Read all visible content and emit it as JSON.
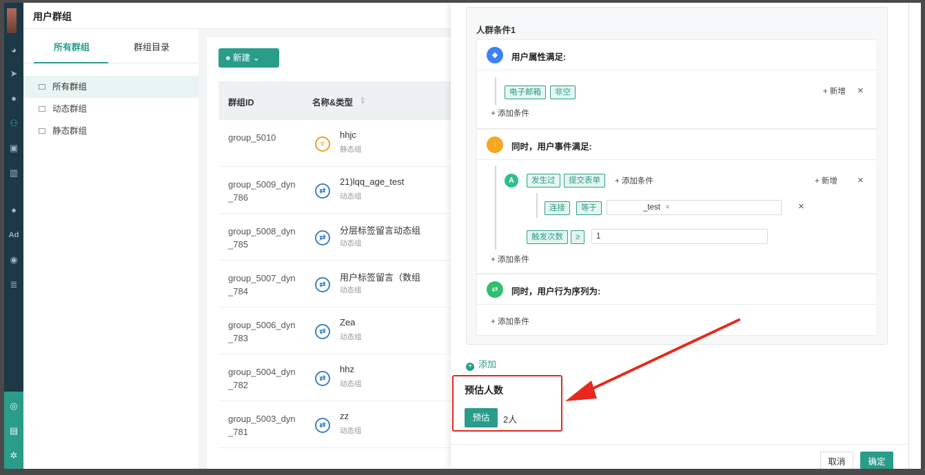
{
  "header": {
    "title": "用户群组"
  },
  "rail": {
    "icons": [
      "dashboard-icon",
      "send-icon",
      "user-icon",
      "users-icon",
      "bookmark-icon",
      "chart-icon",
      "wechat-icon",
      "ad-icon",
      "target-icon",
      "list-icon",
      "monitor-icon",
      "storage-icon",
      "settings-icon"
    ],
    "ad_label": "Ad"
  },
  "tree": {
    "tabs": [
      {
        "label": "所有群组"
      },
      {
        "label": "群组目录"
      }
    ],
    "items": [
      {
        "label": "所有群组"
      },
      {
        "label": "动态群组"
      },
      {
        "label": "静态群组"
      }
    ]
  },
  "list": {
    "new_button": "新建",
    "columns": {
      "id": "群组ID",
      "name": "名称&类型"
    },
    "rows": [
      {
        "id": "group_5010",
        "name": "hhjc",
        "type": "静态组",
        "icon": "static-group-icon"
      },
      {
        "id": "group_5009_dyn_786",
        "name": "21)lqq_age_test",
        "type": "动态组",
        "icon": "dynamic-group-icon"
      },
      {
        "id": "group_5008_dyn_785",
        "name": "分层标签留言动态组",
        "type": "动态组",
        "icon": "dynamic-group-icon"
      },
      {
        "id": "group_5007_dyn_784",
        "name": "用户标签留言（数组",
        "type": "动态组",
        "icon": "dynamic-group-icon"
      },
      {
        "id": "group_5006_dyn_783",
        "name": "Zea",
        "type": "动态组",
        "icon": "dynamic-group-icon"
      },
      {
        "id": "group_5004_dyn_782",
        "name": "hhz",
        "type": "动态组",
        "icon": "dynamic-group-icon"
      },
      {
        "id": "group_5003_dyn_781",
        "name": "zz",
        "type": "动态组",
        "icon": "dynamic-group-icon"
      }
    ]
  },
  "drawer": {
    "card_title": "人群条件1",
    "attr": {
      "title": "用户属性满足:",
      "tags": [
        "电子邮箱",
        "非空"
      ],
      "add_new": "+ 新增",
      "add_condition": "+ 添加条件",
      "close": "×",
      "color": "#3b82f6"
    },
    "event": {
      "title": "同时，用户事件满足:",
      "badge": "A",
      "tags": [
        "发生过",
        "提交表单"
      ],
      "inline_add": "+ 添加条件",
      "add_new": "+ 新增",
      "close": "×",
      "filter": {
        "tags": [
          "连接",
          "等于"
        ],
        "value": "_test",
        "value_close": "×",
        "close": "×"
      },
      "count": {
        "tags": [
          "触发次数",
          "≥"
        ],
        "value": "1"
      },
      "add_condition": "+ 添加条件",
      "color": "#f5a623"
    },
    "sequence": {
      "title": "同时，用户行为序列为:",
      "add_condition": "+ 添加条件",
      "color": "#2fbf6e"
    },
    "add": "添加",
    "estimate": {
      "title": "预估人数",
      "button": "预估",
      "value": "2人"
    },
    "footer": {
      "cancel": "取消",
      "ok": "确定"
    }
  },
  "colors": {
    "accent": "#2a9c8a",
    "highlight": "#e0281e"
  }
}
